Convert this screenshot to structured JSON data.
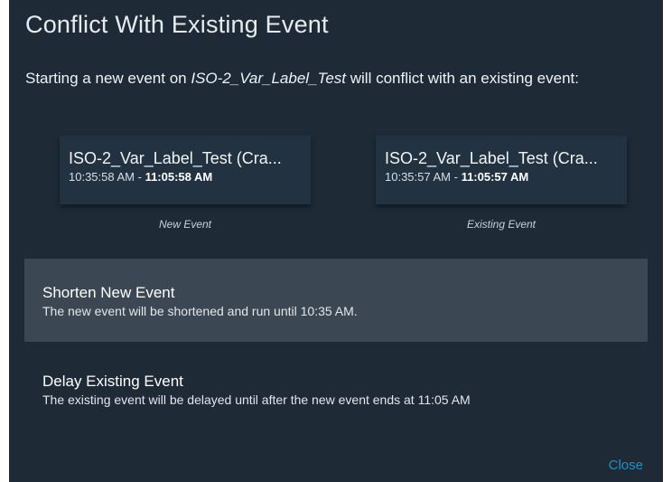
{
  "dialog": {
    "title": "Conflict With Existing Event",
    "message": {
      "prefix": "Starting a new event on ",
      "event_name": "ISO-2_Var_Label_Test",
      "suffix": " will conflict with an existing event:"
    },
    "new_event": {
      "name": "ISO-2_Var_Label_Test (Cra...",
      "start_time": "10:35:58 AM",
      "separator": " - ",
      "end_time": "11:05:58 AM",
      "caption": "New Event"
    },
    "existing_event": {
      "name": "ISO-2_Var_Label_Test (Cra...",
      "start_time": "10:35:57 AM",
      "separator": " - ",
      "end_time": "11:05:57 AM",
      "caption": "Existing Event"
    },
    "options": {
      "shorten": {
        "title": "Shorten New Event",
        "description": "The new event will be shortened and run until 10:35 AM."
      },
      "delay": {
        "title": "Delay Existing Event",
        "description": "The existing event will be delayed until after the new event ends at 11:05 AM"
      }
    },
    "close_label": "Close",
    "colors": {
      "background": "#1e2b37",
      "card": "#233240",
      "highlight": "#3b4854",
      "link": "#1f8fc6"
    }
  }
}
